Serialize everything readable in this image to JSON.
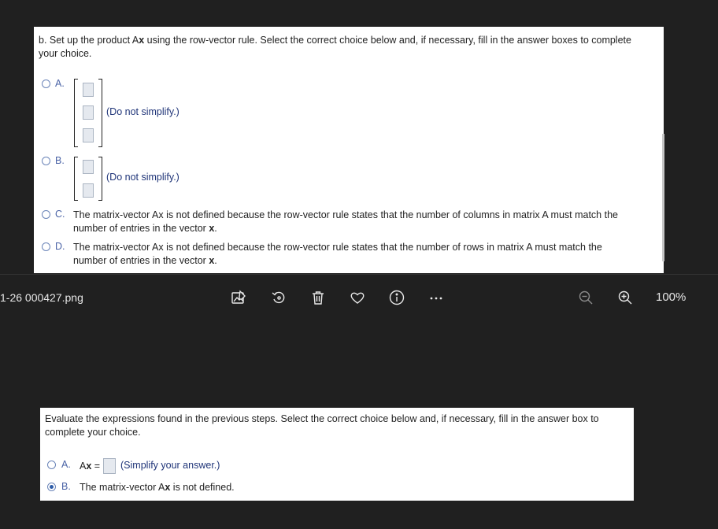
{
  "top_panel": {
    "instruction_prefix": "b. Set up the product A",
    "instruction_bold": "x",
    "instruction_rest": " using the row-vector rule. Select the correct choice below and, if necessary, fill in the answer boxes to complete",
    "instruction_line2": "your choice.",
    "options": [
      {
        "label": "A.",
        "hint": "(Do not simplify.)"
      },
      {
        "label": "B.",
        "hint": "(Do not simplify.)"
      },
      {
        "label": "C.",
        "line1": "The matrix-vector Ax is not defined because the row-vector rule states that the number of columns in matrix A must match the",
        "line2_prefix": "number of entries in the vector ",
        "line2_bold": "x",
        "line2_suffix": "."
      },
      {
        "label": "D.",
        "line1": "The matrix-vector Ax is not defined because the row-vector rule states that the number of rows in matrix A must match the",
        "line2_prefix": "number of entries in the vector ",
        "line2_bold": "x",
        "line2_suffix": "."
      }
    ]
  },
  "toolbar": {
    "filename": "1-26 000427.png",
    "zoom": "100%",
    "icons": [
      "edit-image-icon",
      "rotate-icon",
      "delete-icon",
      "favorite-icon",
      "info-icon",
      "more-icon",
      "zoom-out-icon",
      "zoom-in-icon"
    ]
  },
  "bottom_panel": {
    "instruction_line1": "Evaluate the expressions found in the previous steps. Select the correct choice below and, if necessary, fill in the answer box to",
    "instruction_line2": "complete your choice.",
    "options": [
      {
        "label": "A.",
        "expr_prefix": "A",
        "expr_bold": "x",
        "expr_suffix": " =",
        "hint": "(Simplify your answer.)",
        "selected": false
      },
      {
        "label": "B.",
        "text_prefix": "The matrix-vector A",
        "text_bold": "x",
        "text_suffix": " is not defined.",
        "selected": true
      }
    ]
  },
  "colors": {
    "background": "#202020",
    "panel": "#ffffff",
    "option_label": "#4a63a6",
    "hint": "#1f3478",
    "radio_selected": "#2d5ca8"
  }
}
